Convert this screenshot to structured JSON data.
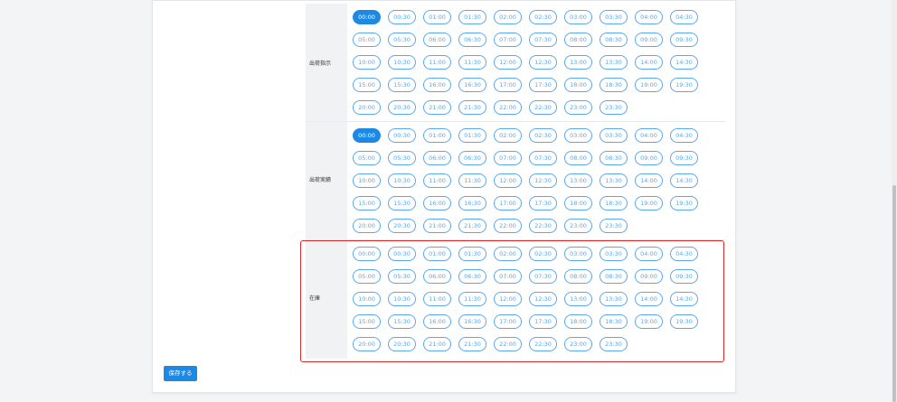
{
  "times": [
    "00:00",
    "00:30",
    "01:00",
    "01:30",
    "02:00",
    "02:30",
    "03:00",
    "03:30",
    "04:00",
    "04:30",
    "05:00",
    "05:30",
    "06:00",
    "06:30",
    "07:00",
    "07:30",
    "08:00",
    "08:30",
    "09:00",
    "09:30",
    "10:00",
    "10:30",
    "11:00",
    "11:30",
    "12:00",
    "12:30",
    "13:00",
    "13:30",
    "14:00",
    "14:30",
    "15:00",
    "15:30",
    "16:00",
    "16:30",
    "17:00",
    "17:30",
    "18:00",
    "18:30",
    "19:00",
    "19:30",
    "20:00",
    "20:30",
    "21:00",
    "21:30",
    "22:00",
    "22:30",
    "23:00",
    "23:30"
  ],
  "sections": [
    {
      "label": "出荷指示",
      "selected": "00:00"
    },
    {
      "label": "出荷実績",
      "selected": "00:00"
    },
    {
      "label": "在庫",
      "selected": null
    }
  ],
  "actions": {
    "save_label": "保存する"
  },
  "colors": {
    "accent": "#1e88e5",
    "highlight": "#d42a2a"
  }
}
